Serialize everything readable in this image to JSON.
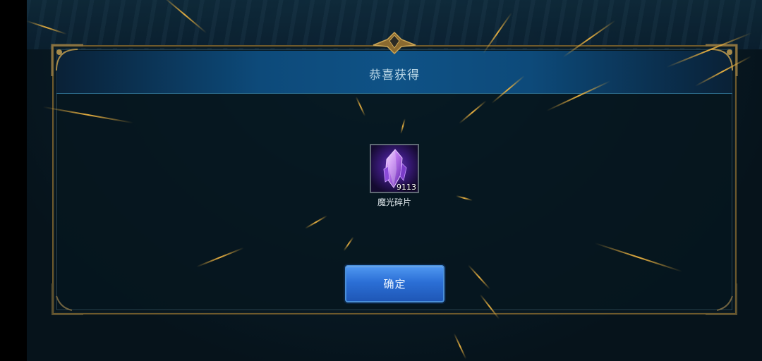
{
  "dialog": {
    "title": "恭喜获得",
    "confirm_label": "确定"
  },
  "reward": {
    "icon": "crystal-shard-icon",
    "count": "9113",
    "name": "魔光碎片"
  },
  "colors": {
    "frame_gold": "#6f5a2c",
    "header_blue": "#0f5286",
    "button_blue": "#2b6fd6",
    "ray_gold": "#e8b040",
    "item_purple": "#6a3bb8"
  }
}
